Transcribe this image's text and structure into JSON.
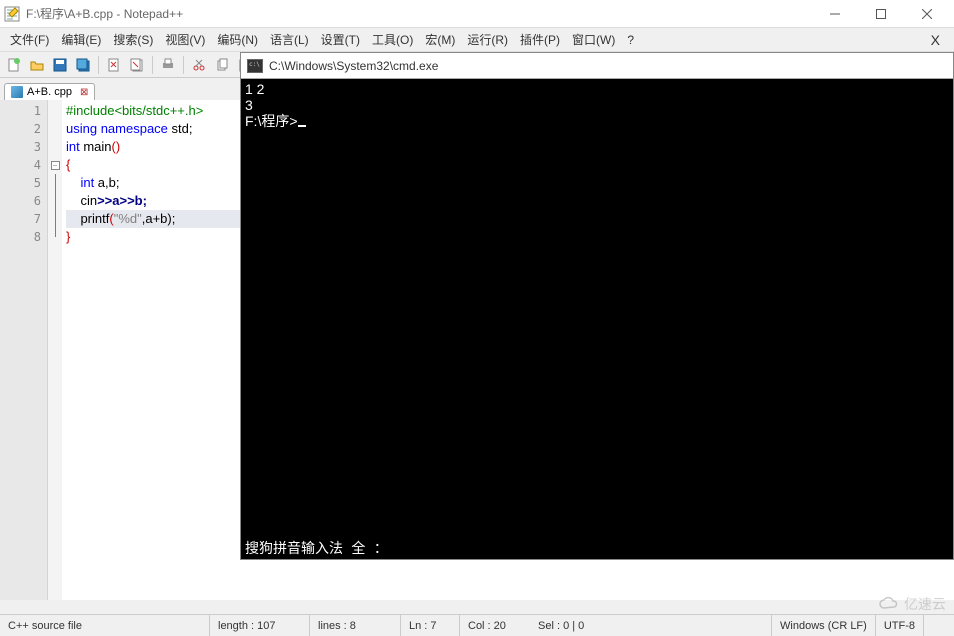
{
  "titlebar": {
    "title": "F:\\程序\\A+B.cpp - Notepad++"
  },
  "menu": {
    "items": [
      "文件(F)",
      "编辑(E)",
      "搜索(S)",
      "视图(V)",
      "编码(N)",
      "语言(L)",
      "设置(T)",
      "工具(O)",
      "宏(M)",
      "运行(R)",
      "插件(P)",
      "窗口(W)",
      "?"
    ],
    "x": "X"
  },
  "tab": {
    "name": "A+B. cpp"
  },
  "lines": [
    "1",
    "2",
    "3",
    "4",
    "5",
    "6",
    "7",
    "8"
  ],
  "code": {
    "l1_inc": "#include",
    "l1_hdr": "<bits/stdc++.h>",
    "l2_using": "using",
    "l2_ns": " namespace ",
    "l2_std": "std",
    "l2_semi": ";",
    "l3_int": "int",
    "l3_main": " main",
    "l3_paren": "()",
    "l4_brace": "{",
    "l5_int": "int",
    "l5_vars": " a,b;",
    "l6_cin": "cin",
    "l6_rest": ">>a>>b;",
    "l7_printf": "printf",
    "l7_open": "(",
    "l7_str": "\"%d\"",
    "l7_rest": ",a+b);",
    "l8_brace": "}"
  },
  "cmd": {
    "title": "C:\\Windows\\System32\\cmd.exe",
    "l1": "1 2",
    "l2": "3",
    "l3": "F:\\程序>",
    "ime": "搜狗拼音输入法  全 ："
  },
  "status": {
    "type": "C++ source file",
    "length": "length : 107",
    "lines": "lines : 8",
    "ln": "Ln : 7",
    "col": "Col : 20",
    "sel": "Sel : 0 | 0",
    "eol": "Windows (CR LF)",
    "enc": "UTF-8"
  },
  "watermark": "亿速云"
}
